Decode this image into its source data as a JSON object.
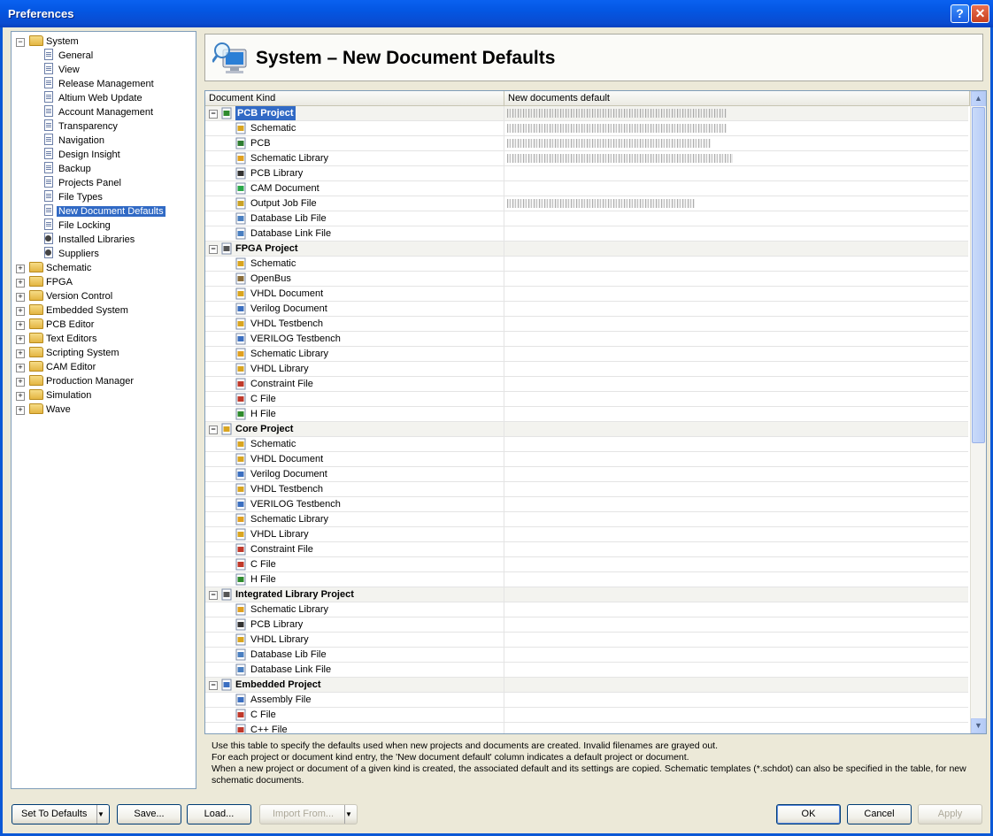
{
  "window": {
    "title": "Preferences"
  },
  "tree": [
    {
      "label": "System",
      "level": 0,
      "kind": "folder",
      "expanded": true
    },
    {
      "label": "General",
      "level": 1,
      "kind": "page"
    },
    {
      "label": "View",
      "level": 1,
      "kind": "page"
    },
    {
      "label": "Release Management",
      "level": 1,
      "kind": "page"
    },
    {
      "label": "Altium Web Update",
      "level": 1,
      "kind": "page"
    },
    {
      "label": "Account Management",
      "level": 1,
      "kind": "page"
    },
    {
      "label": "Transparency",
      "level": 1,
      "kind": "page"
    },
    {
      "label": "Navigation",
      "level": 1,
      "kind": "page"
    },
    {
      "label": "Design Insight",
      "level": 1,
      "kind": "page"
    },
    {
      "label": "Backup",
      "level": 1,
      "kind": "page"
    },
    {
      "label": "Projects Panel",
      "level": 1,
      "kind": "page"
    },
    {
      "label": "File Types",
      "level": 1,
      "kind": "page"
    },
    {
      "label": "New Document Defaults",
      "level": 1,
      "kind": "page",
      "selected": true
    },
    {
      "label": "File Locking",
      "level": 1,
      "kind": "page"
    },
    {
      "label": "Installed Libraries",
      "level": 1,
      "kind": "gear"
    },
    {
      "label": "Suppliers",
      "level": 1,
      "kind": "gear"
    },
    {
      "label": "Schematic",
      "level": 0,
      "kind": "folder"
    },
    {
      "label": "FPGA",
      "level": 0,
      "kind": "folder"
    },
    {
      "label": "Version Control",
      "level": 0,
      "kind": "folder"
    },
    {
      "label": "Embedded System",
      "level": 0,
      "kind": "folder"
    },
    {
      "label": "PCB Editor",
      "level": 0,
      "kind": "folder"
    },
    {
      "label": "Text Editors",
      "level": 0,
      "kind": "folder"
    },
    {
      "label": "Scripting System",
      "level": 0,
      "kind": "folder"
    },
    {
      "label": "CAM Editor",
      "level": 0,
      "kind": "folder"
    },
    {
      "label": "Production Manager",
      "level": 0,
      "kind": "folder"
    },
    {
      "label": "Simulation",
      "level": 0,
      "kind": "folder"
    },
    {
      "label": "Wave",
      "level": 0,
      "kind": "folder"
    }
  ],
  "header": {
    "title": "System – New Document Defaults"
  },
  "grid": {
    "columns": [
      "Document Kind",
      "New documents default"
    ],
    "rows": [
      {
        "label": "PCB Project",
        "project": true,
        "selected": true,
        "icon": "pcb-project",
        "color": "#2e8b2e"
      },
      {
        "label": "Schematic",
        "icon": "schematic",
        "color": "#d9a520"
      },
      {
        "label": "PCB",
        "icon": "pcb",
        "color": "#2f7d32"
      },
      {
        "label": "Schematic Library",
        "icon": "schematic-library",
        "color": "#e0a020"
      },
      {
        "label": "PCB Library",
        "icon": "pcb-library",
        "color": "#333333"
      },
      {
        "label": "CAM Document",
        "icon": "cam",
        "color": "#2aa84a"
      },
      {
        "label": "Output Job File",
        "icon": "output-job",
        "color": "#c9a227"
      },
      {
        "label": "Database Lib File",
        "icon": "database-lib",
        "color": "#4a7fc1"
      },
      {
        "label": "Database Link File",
        "icon": "database-link",
        "color": "#4a7fc1"
      },
      {
        "label": "FPGA Project",
        "project": true,
        "icon": "fpga-project",
        "color": "#555555"
      },
      {
        "label": "Schematic",
        "icon": "schematic",
        "color": "#d9a520"
      },
      {
        "label": "OpenBus",
        "icon": "openbus",
        "color": "#8a6d3b"
      },
      {
        "label": "VHDL Document",
        "icon": "vhdl",
        "color": "#d9a520"
      },
      {
        "label": "Verilog Document",
        "icon": "verilog",
        "color": "#3b6fc1"
      },
      {
        "label": "VHDL Testbench",
        "icon": "vhdl-testbench",
        "color": "#d9a520"
      },
      {
        "label": "VERILOG Testbench",
        "icon": "verilog-testbench",
        "color": "#3b6fc1"
      },
      {
        "label": "Schematic Library",
        "icon": "schematic-library",
        "color": "#e0a020"
      },
      {
        "label": "VHDL Library",
        "icon": "vhdl-library",
        "color": "#d9a520"
      },
      {
        "label": "Constraint File",
        "icon": "constraint",
        "color": "#c0392b"
      },
      {
        "label": "C File",
        "icon": "c-file",
        "color": "#c0392b"
      },
      {
        "label": "H File",
        "icon": "h-file",
        "color": "#2e8b2e"
      },
      {
        "label": "Core Project",
        "project": true,
        "icon": "core-project",
        "color": "#d9a520"
      },
      {
        "label": "Schematic",
        "icon": "schematic",
        "color": "#d9a520"
      },
      {
        "label": "VHDL Document",
        "icon": "vhdl",
        "color": "#d9a520"
      },
      {
        "label": "Verilog Document",
        "icon": "verilog",
        "color": "#3b6fc1"
      },
      {
        "label": "VHDL Testbench",
        "icon": "vhdl-testbench",
        "color": "#d9a520"
      },
      {
        "label": "VERILOG Testbench",
        "icon": "verilog-testbench",
        "color": "#3b6fc1"
      },
      {
        "label": "Schematic Library",
        "icon": "schematic-library",
        "color": "#e0a020"
      },
      {
        "label": "VHDL Library",
        "icon": "vhdl-library",
        "color": "#d9a520"
      },
      {
        "label": "Constraint File",
        "icon": "constraint",
        "color": "#c0392b"
      },
      {
        "label": "C File",
        "icon": "c-file",
        "color": "#c0392b"
      },
      {
        "label": "H File",
        "icon": "h-file",
        "color": "#2e8b2e"
      },
      {
        "label": "Integrated Library Project",
        "project": true,
        "icon": "intlib-project",
        "color": "#555555"
      },
      {
        "label": "Schematic Library",
        "icon": "schematic-library",
        "color": "#e0a020"
      },
      {
        "label": "PCB Library",
        "icon": "pcb-library",
        "color": "#333333"
      },
      {
        "label": "VHDL Library",
        "icon": "vhdl-library",
        "color": "#d9a520"
      },
      {
        "label": "Database Lib File",
        "icon": "database-lib",
        "color": "#4a7fc1"
      },
      {
        "label": "Database Link File",
        "icon": "database-link",
        "color": "#4a7fc1"
      },
      {
        "label": "Embedded Project",
        "project": true,
        "icon": "embedded-project",
        "color": "#3b6fc1"
      },
      {
        "label": "Assembly File",
        "icon": "assembly",
        "color": "#3b6fc1"
      },
      {
        "label": "C File",
        "icon": "c-file",
        "color": "#c0392b"
      },
      {
        "label": "C++ File",
        "icon": "cpp-file",
        "color": "#c0392b"
      }
    ]
  },
  "description": [
    "Use this table to specify the defaults used when new projects and documents are created. Invalid filenames are grayed out.",
    "For each project or document kind entry, the 'New document default' column indicates a default project or document.",
    "When a new project or document of a given kind is created, the associated default and its settings are copied. Schematic templates (*.schdot) can also be specified in the table, for new",
    "schematic documents."
  ],
  "buttons": {
    "set_defaults": "Set To Defaults",
    "save": "Save...",
    "load": "Load...",
    "import_from": "Import From...",
    "ok": "OK",
    "cancel": "Cancel",
    "apply": "Apply"
  }
}
